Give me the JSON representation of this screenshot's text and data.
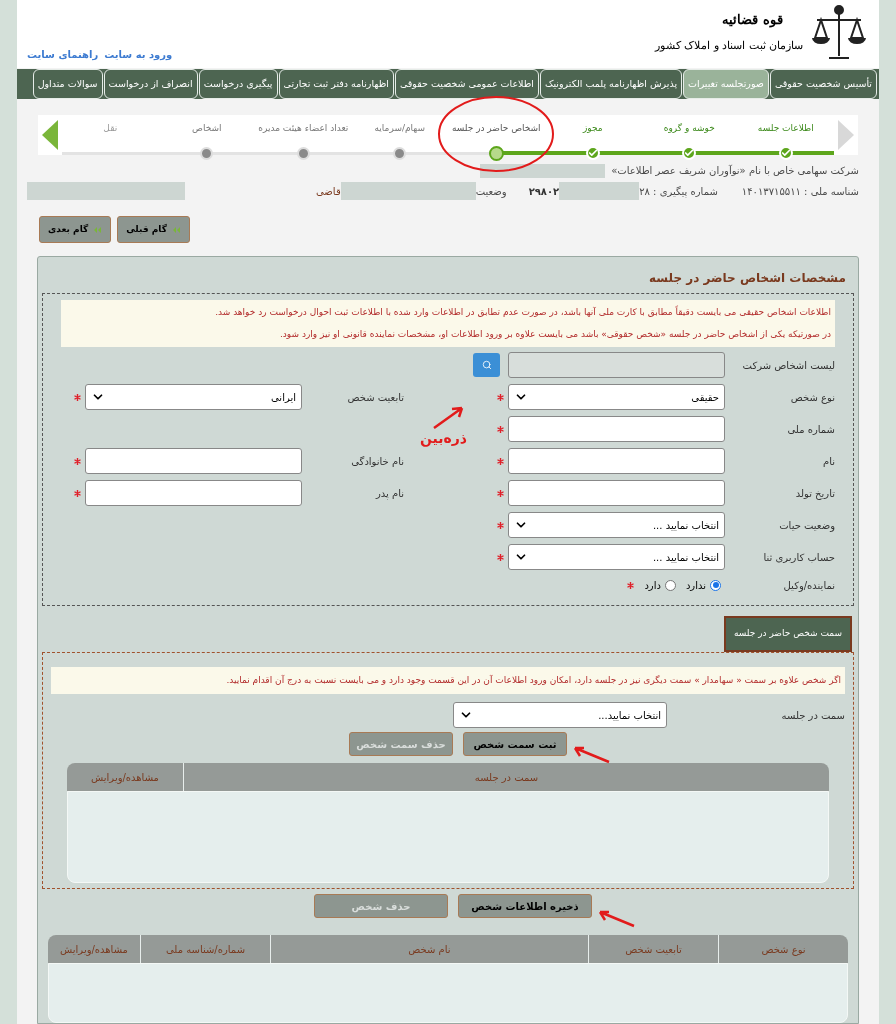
{
  "header": {
    "org_title": "قوه قضائیه",
    "org_subtitle": "سازمان ثبت اسناد و املاک کشور",
    "links": [
      "ورود به سایت",
      "راهنمای سایت"
    ]
  },
  "nav": [
    {
      "label": "تأسیس شخصیت حقوقی",
      "selected": false
    },
    {
      "label": "صورتجلسه تغییرات",
      "selected": true
    },
    {
      "label": "پذیرش اظهارنامه پلمب الکترونیک",
      "selected": false
    },
    {
      "label": "اطلاعات عمومی شخصیت حقوقی",
      "selected": false
    },
    {
      "label": "اظهارنامه دفتر ثبت تجارتی",
      "selected": false
    },
    {
      "label": "پیگیری درخواست",
      "selected": false
    },
    {
      "label": "انصراف از درخواست",
      "selected": false
    },
    {
      "label": "سوالات متداول",
      "selected": false
    }
  ],
  "stepper": {
    "prev_enabled": false,
    "next_enabled": true,
    "steps": [
      {
        "label": "اطلاعات جلسه",
        "kind": "done"
      },
      {
        "label": "خوشه و گروه",
        "kind": "done"
      },
      {
        "label": "مجوز",
        "kind": "done"
      },
      {
        "label": "اشخاص حاضر در جلسه",
        "kind": "current"
      },
      {
        "label": "سهام/سرمایه",
        "kind": "pending"
      },
      {
        "label": "تعداد اعضاء هیئت مدیره",
        "kind": "pending"
      },
      {
        "label": "اشخاص",
        "kind": "pending"
      },
      {
        "label": "نقل",
        "kind": "faded"
      }
    ]
  },
  "company": {
    "title": "شرکت سهامی خاص با نام «نوآوران شریف عصر اطلاعات»",
    "national_id": "شناسه ملی : ۱۴۰۱۳۷۱۵۵۱۱",
    "tracking": "شماره پیگیری : ۲۸",
    "tracking_tail": "۲۹۸۰۲",
    "status_label": "وضعیت",
    "status_tail": "قاضی"
  },
  "step_buttons": [
    "گام قبلی",
    "گام بعدی"
  ],
  "person_section": {
    "title": "مشخصات اشخاص حاضر در جلسه",
    "notice": [
      "اطلاعات اشخاص حقیقی می بایست دقیقاً مطابق با کارت ملی آنها باشد، در صورت عدم تطابق در اطلاعات وارد شده با اطلاعات ثبت احوال درخواست رد خواهد شد.",
      "در صورتیکه یکی از اشخاص حاضر در جلسه «شخص حقوقی» باشد می بایست علاوه بر ورود اطلاعات او، مشخصات نماینده قانونی او نیز وارد شود."
    ],
    "rows": [
      [
        {
          "label": "لیست اشخاص شرکت",
          "kind": "lookup"
        }
      ],
      [
        {
          "label": "نوع شخص",
          "kind": "select",
          "value": "حقیقی",
          "required": true
        },
        {
          "label": "تابعیت شخص",
          "kind": "select",
          "value": "ایرانی",
          "required": true
        }
      ],
      [
        {
          "label": "شماره ملی",
          "kind": "text",
          "required": true
        }
      ],
      [
        {
          "label": "نام",
          "kind": "text",
          "required": true
        },
        {
          "label": "نام خانوادگی",
          "kind": "text",
          "required": true
        }
      ],
      [
        {
          "label": "تاریخ تولد",
          "kind": "text",
          "required": true
        },
        {
          "label": "نام پدر",
          "kind": "text",
          "required": true
        }
      ],
      [
        {
          "label": "وضعیت حیات",
          "kind": "select",
          "value": "انتخاب نمایید ...",
          "required": true
        }
      ],
      [
        {
          "label": "حساب کاربری ثنا",
          "kind": "select",
          "value": "انتخاب نمایید ...",
          "required": true
        }
      ],
      [
        {
          "label": "نماینده/وکیل",
          "kind": "radio",
          "required": true,
          "options": [
            {
              "label": "ندارد",
              "selected": true
            },
            {
              "label": "دارد",
              "selected": false
            }
          ]
        }
      ]
    ]
  },
  "annotation": {
    "label": "ذره‌بین"
  },
  "role_section": {
    "tab": "سمت شخص حاضر در جلسه",
    "notice": "اگر شخص علاوه بر سمت « سهامدار » سمت دیگری نیز در جلسه دارد، امکان ورود اطلاعات آن در این قسمت وجود دارد و می بایست نسبت به درج آن اقدام نمایید.",
    "field": {
      "label": "سمت در جلسه",
      "value": "انتخاب نمایید..."
    },
    "buttons": [
      {
        "label": "ثبت سمت شخص",
        "disabled": false
      },
      {
        "label": "حذف سمت شخص",
        "disabled": true
      }
    ],
    "columns": [
      "سمت در جلسه",
      "مشاهده/ویرایش"
    ]
  },
  "person_buttons": [
    {
      "label": "ذخیره اطلاعات شخص",
      "disabled": false
    },
    {
      "label": "حذف شخص",
      "disabled": true
    }
  ],
  "person_table": {
    "columns": [
      "نوع شخص",
      "تابعیت شخص",
      "نام شخص",
      "شماره/شناسه ملی",
      "مشاهده/ویرایش"
    ]
  }
}
